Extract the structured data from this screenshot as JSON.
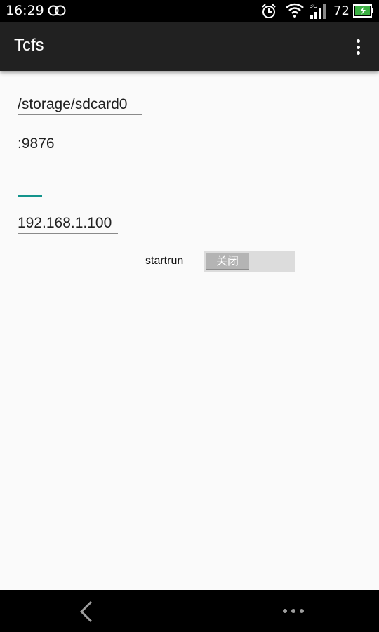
{
  "status_bar": {
    "time": "16:29",
    "network_type": "3G",
    "battery_percent": "72",
    "icons": [
      "infinity-icon",
      "alarm-icon",
      "wifi-icon",
      "signal-icon",
      "battery-icon"
    ]
  },
  "app_bar": {
    "title": "Tcfs",
    "menu_icon": "overflow-menu-icon"
  },
  "form": {
    "path_value": "/storage/sdcard0",
    "port_value": ":9876",
    "empty_value": "",
    "ip_value": "192.168.1.100",
    "switch_label": "startrun",
    "switch_state_label": "关闭",
    "switch_on": false
  },
  "nav_bar": {
    "back_icon": "back-icon",
    "more_icon": "more-icon"
  },
  "colors": {
    "accent": "#13948c",
    "app_bar": "#212121",
    "background": "#fafafa"
  }
}
